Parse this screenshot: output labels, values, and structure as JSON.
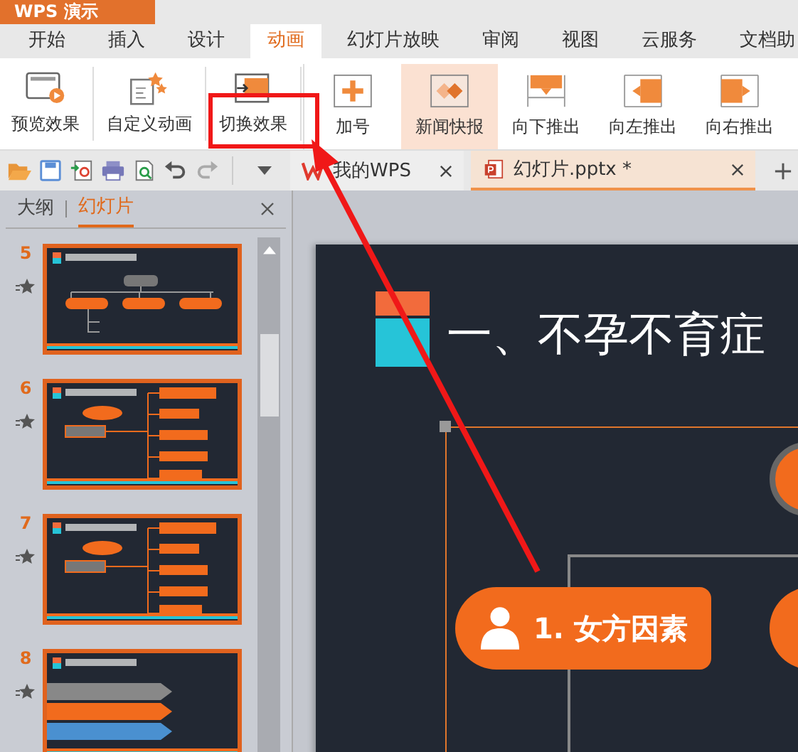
{
  "app_title": "WPS 演示",
  "menu_tabs": [
    {
      "label": "开始",
      "selected": false
    },
    {
      "label": "插入",
      "selected": false
    },
    {
      "label": "设计",
      "selected": false
    },
    {
      "label": "动画",
      "selected": true
    },
    {
      "label": "幻灯片放映",
      "selected": false
    },
    {
      "label": "审阅",
      "selected": false
    },
    {
      "label": "视图",
      "selected": false
    },
    {
      "label": "云服务",
      "selected": false
    },
    {
      "label": "文档助",
      "selected": false
    }
  ],
  "ribbon_tools": [
    {
      "label": "预览效果",
      "kind": "preview"
    },
    {
      "label": "自定义动画",
      "kind": "custom"
    },
    {
      "label": "切换效果",
      "kind": "transition"
    }
  ],
  "effects": [
    {
      "label": "加号",
      "kind": "plus",
      "selected": false
    },
    {
      "label": "新闻快报",
      "kind": "news",
      "selected": true
    },
    {
      "label": "向下推出",
      "kind": "down",
      "selected": false
    },
    {
      "label": "向左推出",
      "kind": "left",
      "selected": false
    },
    {
      "label": "向右推出",
      "kind": "right",
      "selected": false
    }
  ],
  "doc_tabs": [
    {
      "label": "我的WPS",
      "kind": "home",
      "selected": false
    },
    {
      "label": "幻灯片.pptx *",
      "kind": "pptx",
      "selected": true
    }
  ],
  "panel_tabs": [
    {
      "label": "大纲",
      "selected": false
    },
    {
      "label": "幻灯片",
      "selected": true
    }
  ],
  "slides": [
    {
      "number": "5",
      "kind": "tree"
    },
    {
      "number": "6",
      "kind": "map"
    },
    {
      "number": "7",
      "kind": "map"
    },
    {
      "number": "8",
      "kind": "bands"
    }
  ],
  "slide": {
    "title": "一、不孕不育症",
    "node": "1. 女方因素"
  }
}
